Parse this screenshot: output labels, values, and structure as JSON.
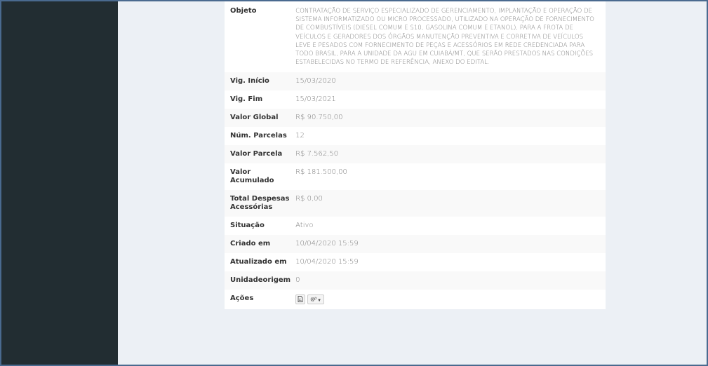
{
  "details": {
    "objeto_label": "Objeto",
    "objeto_value": "CONTRATAÇÃO DE SERVIÇO ESPECIALIZADO DE GERENCIAMENTO, IMPLANTAÇÃO E OPERAÇÃO DE SISTEMA INFORMATIZADO OU MICRO PROCESSADO, UTILIZADO NA OPERAÇÃO DE FORNECIMENTO DE COMBUSTÍVEIS (DIESEL COMUM E S10, GASOLINA COMUM E ETANOL), PARA A FROTA DE VEÍCULOS E GERADORES DOS ÓRGÃOS MANUTENÇÃO PREVENTIVA E CORRETIVA DE VEÍCULOS LEVE E PESADOS COM FORNECIMENTO DE PEÇAS E ACESSÓRIOS EM REDE CREDENCIADA PARA TODO BRASIL, PARA A UNIDADE DA AGU EM CUIABÁ/MT, QUE SERÃO PRESTADOS NAS CONDIÇÕES ESTABELECIDAS NO TERMO DE REFERÊNCIA, ANEXO DO EDITAL.",
    "vig_inicio_label": "Vig. Início",
    "vig_inicio_value": "15/03/2020",
    "vig_fim_label": "Vig. Fim",
    "vig_fim_value": "15/03/2021",
    "valor_global_label": "Valor Global",
    "valor_global_value": "R$ 90.750,00",
    "num_parcelas_label": "Núm. Parcelas",
    "num_parcelas_value": "12",
    "valor_parcela_label": "Valor Parcela",
    "valor_parcela_value": "R$ 7.562,50",
    "valor_acumulado_label": "Valor Acumulado",
    "valor_acumulado_value": "R$ 181.500,00",
    "total_despesas_label": "Total Despesas Acessórias",
    "total_despesas_value": "R$ 0,00",
    "situacao_label": "Situação",
    "situacao_value": "Ativo",
    "criado_em_label": "Criado em",
    "criado_em_value": "10/04/2020 15:59",
    "atualizado_em_label": "Atualizado em",
    "atualizado_em_value": "10/04/2020 15:59",
    "unidadeorigem_label": "Unidadeorigem",
    "unidadeorigem_value": "0",
    "acoes_label": "Ações"
  },
  "actions": {
    "pdf_icon": "file-pdf-icon",
    "gears_icon": "gears-icon"
  },
  "colors": {
    "sidebar": "#222d32",
    "content_bg": "#ecf0f5",
    "frame_border": "#4a6a8f"
  }
}
